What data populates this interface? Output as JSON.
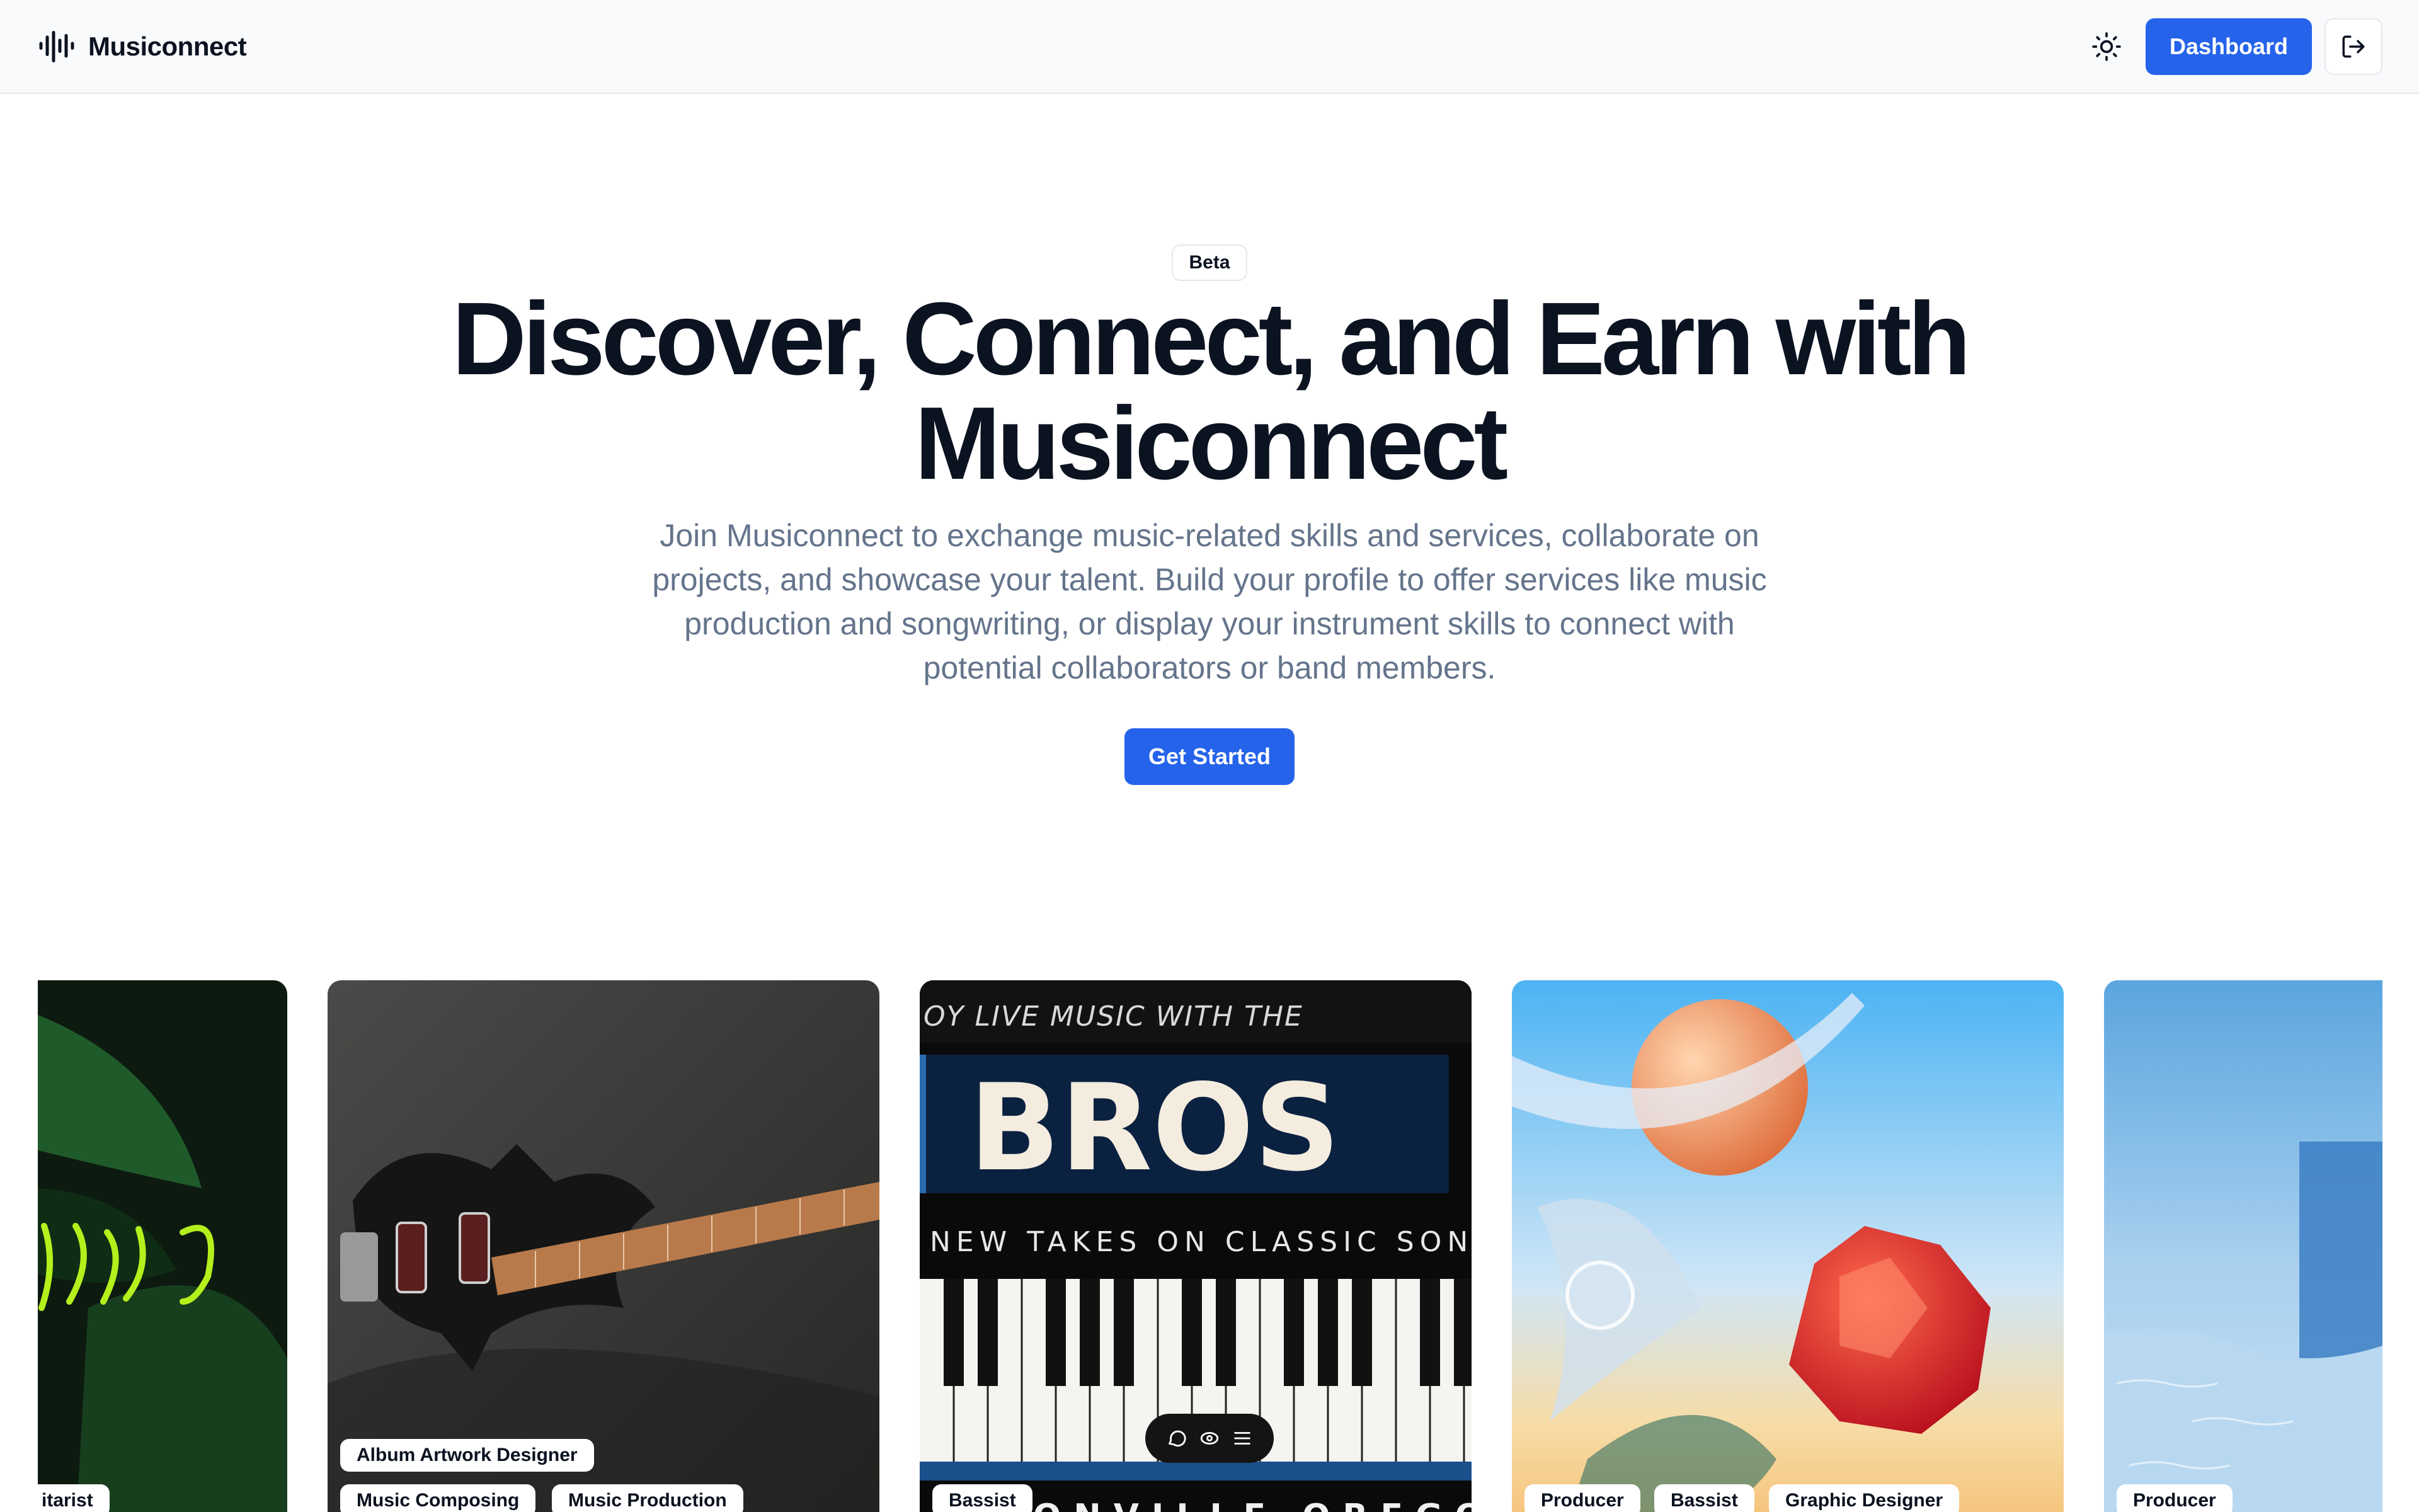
{
  "header": {
    "brand_name": "Musiconnect",
    "brand_icon": "soundwave-icon",
    "theme_icon": "sun-icon",
    "dashboard_label": "Dashboard",
    "logout_icon": "logout-icon"
  },
  "hero": {
    "badge": "Beta",
    "title_line1": "Discover, Connect, and Earn with",
    "title_line2": "Musiconnect",
    "subtitle": "Join Musiconnect to exchange music-related skills and services, collaborate on projects, and showcase your talent. Build your profile to offer services like music production and songwriting, or display your instrument skills to connect with potential collaborators or band members.",
    "cta_label": "Get Started"
  },
  "cards": [
    {
      "tags": [
        "itarist"
      ]
    },
    {
      "tags": [
        "Album Artwork Designer",
        "Music Composing",
        "Music Production"
      ]
    },
    {
      "tags": [
        "Bassist"
      ],
      "poster_top": "OY LIVE MUSIC WITH THE",
      "poster_title": "BROS",
      "poster_sub": "NEW TAKES ON CLASSIC SONGS",
      "poster_bottom": "ONVILLE    OREGO"
    },
    {
      "tags": [
        "Producer",
        "Bassist",
        "Graphic Designer"
      ]
    },
    {
      "tags": [
        "Producer"
      ]
    }
  ],
  "toolbar": {
    "icons": [
      "comment-icon",
      "eye-icon",
      "menu-icon"
    ]
  },
  "colors": {
    "accent": "#2563eb",
    "heading": "#0b1220",
    "muted": "#64748b",
    "header_bg": "#f8fafc"
  }
}
